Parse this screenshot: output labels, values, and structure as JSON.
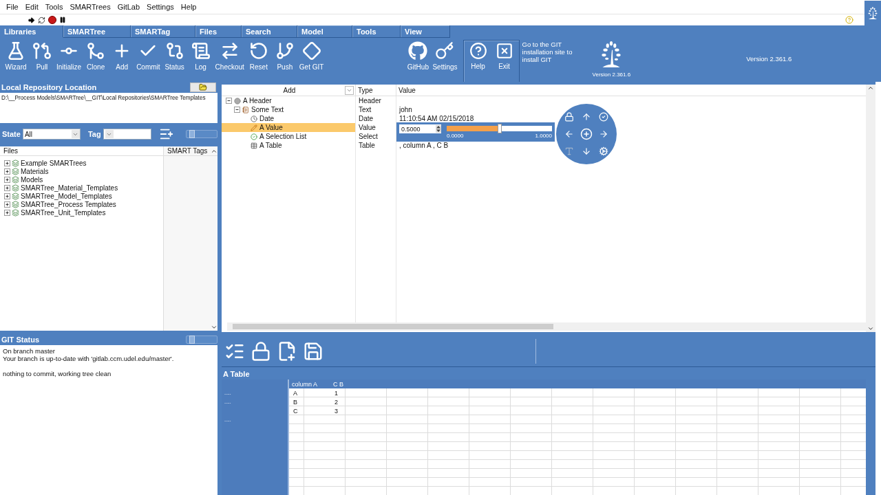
{
  "menu": [
    "File",
    "Edit",
    "Tools",
    "SMARTrees",
    "GitLab",
    "Settings",
    "Help"
  ],
  "ribbon": {
    "tabs": [
      {
        "label": "Libraries",
        "selected": true
      },
      {
        "label": "SMARTree",
        "selected": false
      },
      {
        "label": "SMARTag",
        "selected": false
      },
      {
        "label": "Files",
        "selected": false
      },
      {
        "label": "Search",
        "selected": false
      },
      {
        "label": "Model",
        "selected": false
      },
      {
        "label": "Tools",
        "selected": false
      },
      {
        "label": "View",
        "selected": false
      }
    ],
    "git_buttons": [
      "Wizard",
      "Pull",
      "Initialize",
      "Clone",
      "Add",
      "Commit",
      "Status",
      "Log",
      "Checkout",
      "Reset",
      "Push",
      "Get GIT"
    ],
    "tool_buttons": [
      "GitHub",
      "Settings"
    ],
    "app_buttons": [
      "Help",
      "Exit"
    ],
    "hint": "Go to the GIT installation site to install GIT",
    "logo_version": "Version 2.361.6",
    "version": "Version 2.361.6"
  },
  "repository": {
    "title": "Local Repository Location",
    "path": "D:\\__Process Models\\SMARTree\\__GIT\\Local Repositories\\SMARTree Templates"
  },
  "filters": {
    "state_label": "State",
    "state_value": "All",
    "tag_label": "Tag"
  },
  "files": {
    "columns": [
      "Files",
      "SMART Tags"
    ],
    "items": [
      {
        "label": "Example SMARTrees",
        "expanded": false
      },
      {
        "label": "Materials",
        "expanded": false
      },
      {
        "label": "Models",
        "expanded": false
      },
      {
        "label": "SMARTree_Material_Templates",
        "expanded": false
      },
      {
        "label": "SMARTree_Model_Templates",
        "expanded": false
      },
      {
        "label": "SMARTree_Process Templates",
        "expanded": false
      },
      {
        "label": "SMARTree_Unit_Templates",
        "expanded": false
      }
    ]
  },
  "git_status": {
    "title": "GIT Status",
    "paragraphs": [
      [
        "On branch master",
        "Your branch is up-to-date with 'gitlab.ccm.udel.edu/master'."
      ],
      [
        "nothing to commit, working tree clean"
      ]
    ]
  },
  "property_grid": {
    "columns": [
      "Add",
      "Type",
      "Value"
    ],
    "rows": [
      {
        "kind": "header",
        "name": "A Header",
        "type": "Header",
        "expanded": true,
        "selected": false,
        "children": [
          {
            "kind": "text",
            "name": "Some Text",
            "type": "Text",
            "value": "john",
            "expanded": true,
            "selected": false,
            "children": [
              {
                "kind": "date",
                "name": "Date",
                "type": "Date",
                "value": "11:10:54 AM 02/15/2018",
                "selected": false
              },
              {
                "kind": "value",
                "name": "A Value",
                "type": "Value",
                "selected": true
              },
              {
                "kind": "select",
                "name": "A Selection List",
                "type": "Select",
                "selected": false
              },
              {
                "kind": "table",
                "name": "A Table",
                "type": "Table",
                "value": ", column A , C B",
                "selected": false
              }
            ]
          }
        ]
      }
    ]
  },
  "value_editor": {
    "value": "0.5000",
    "level": 0.5,
    "min": "0.0000",
    "max": "1.0000"
  },
  "navigator": {
    "buttons": [
      {
        "disabled": false
      },
      {
        "disabled": false
      },
      {
        "disabled": false
      },
      {
        "disabled": false
      },
      {
        "disabled": false
      },
      {
        "disabled": false
      },
      {
        "disabled": true
      },
      {
        "disabled": false
      },
      {
        "disabled": false
      }
    ]
  },
  "table": {
    "title": "A Table",
    "columns": [
      "column A",
      "C B"
    ],
    "rows": [
      {
        "marker": ".....",
        "cells": [
          "A",
          "1"
        ]
      },
      {
        "marker": ".....",
        "cells": [
          "B",
          "2"
        ]
      },
      {
        "cells": [
          "C",
          "3"
        ]
      },
      {
        "marker": "....."
      }
    ]
  }
}
